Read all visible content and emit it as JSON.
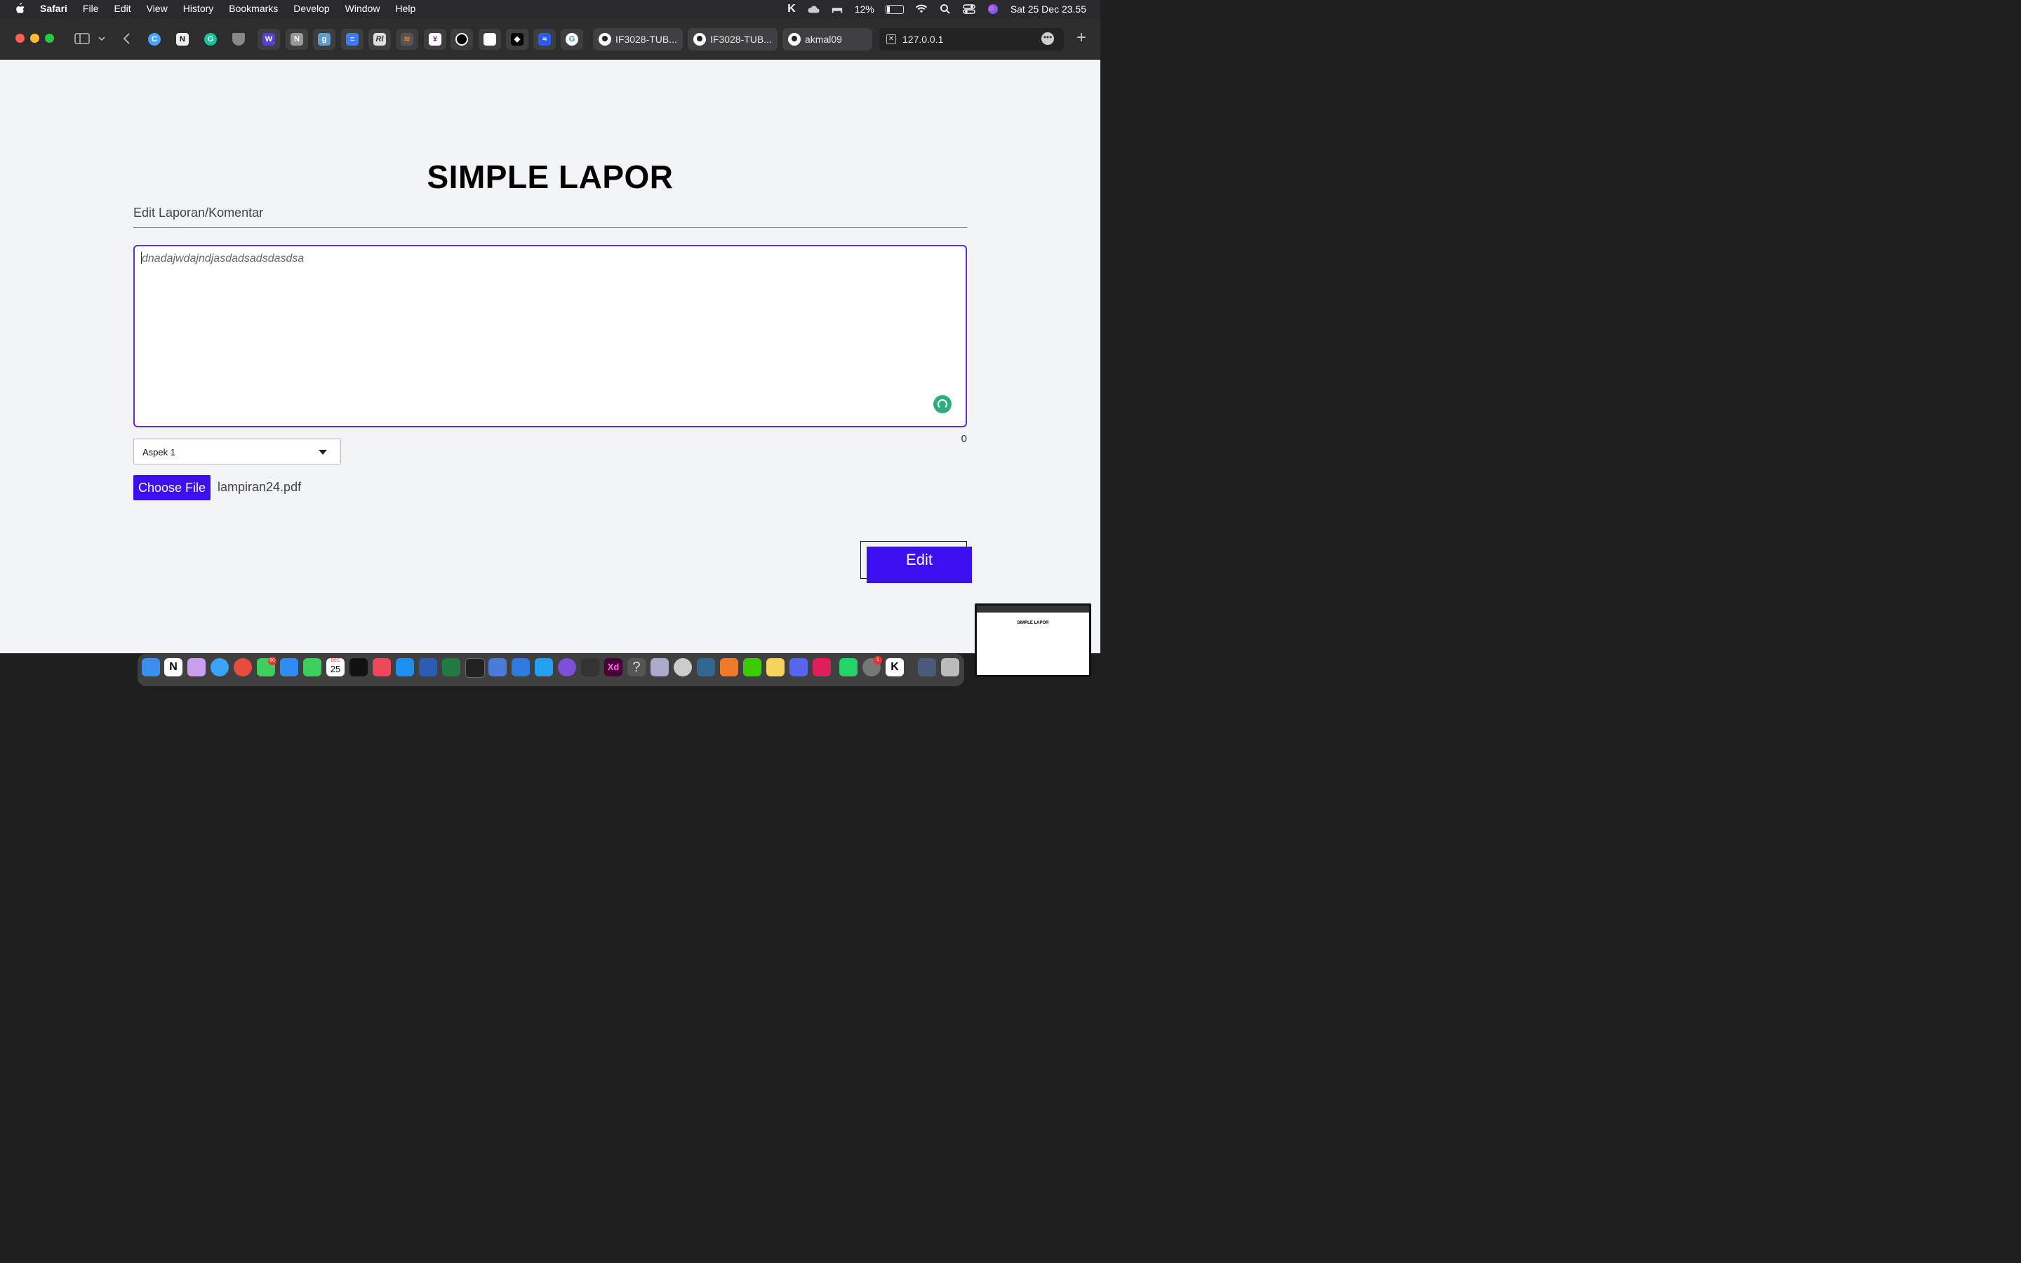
{
  "menubar": {
    "app_name": "Safari",
    "menus": [
      "File",
      "Edit",
      "View",
      "History",
      "Bookmarks",
      "Develop",
      "Window",
      "Help"
    ],
    "battery_percent": "12%",
    "datetime": "Sat 25 Dec  23.55"
  },
  "favorites": [
    "c-icon",
    "notion-icon",
    "grammarly-icon",
    "shield-icon",
    "w-icon",
    "n-icon",
    "g-icon",
    "docs-icon",
    "rl-icon",
    "stack-icon",
    "ekko-icon",
    "circle-icon",
    "apple-icon",
    "bird-icon",
    "wave-icon",
    "google-icon"
  ],
  "tabs": [
    {
      "label": "IF3028-TUB...",
      "icon": "github-icon"
    },
    {
      "label": "IF3028-TUB...",
      "icon": "github-icon"
    },
    {
      "label": "akmal09",
      "icon": "github-icon"
    },
    {
      "label": "127.0.0.1",
      "icon": "close-icon",
      "active": true
    }
  ],
  "page": {
    "title": "SIMPLE LAPOR",
    "subtitle": "Edit Laporan/Komentar",
    "textarea_value": "dnadajwdajndjasdadsadsdasdsa",
    "char_count": "0",
    "select_value": "Aspek 1",
    "choose_file_label": "Choose File",
    "file_name": "lampiran24.pdf",
    "edit_label": "Edit"
  },
  "dock": {
    "messages_badge": "60",
    "calendar_month": "DEC",
    "calendar_day": "25",
    "settings_badge": "1",
    "xd_label": "Xd"
  },
  "thumbnail": {
    "title": "SIMPLE LAPOR"
  },
  "colors": {
    "accent": "#3b0ff0",
    "focus_border": "#5b2be0",
    "page_bg": "#f3f4f6"
  }
}
